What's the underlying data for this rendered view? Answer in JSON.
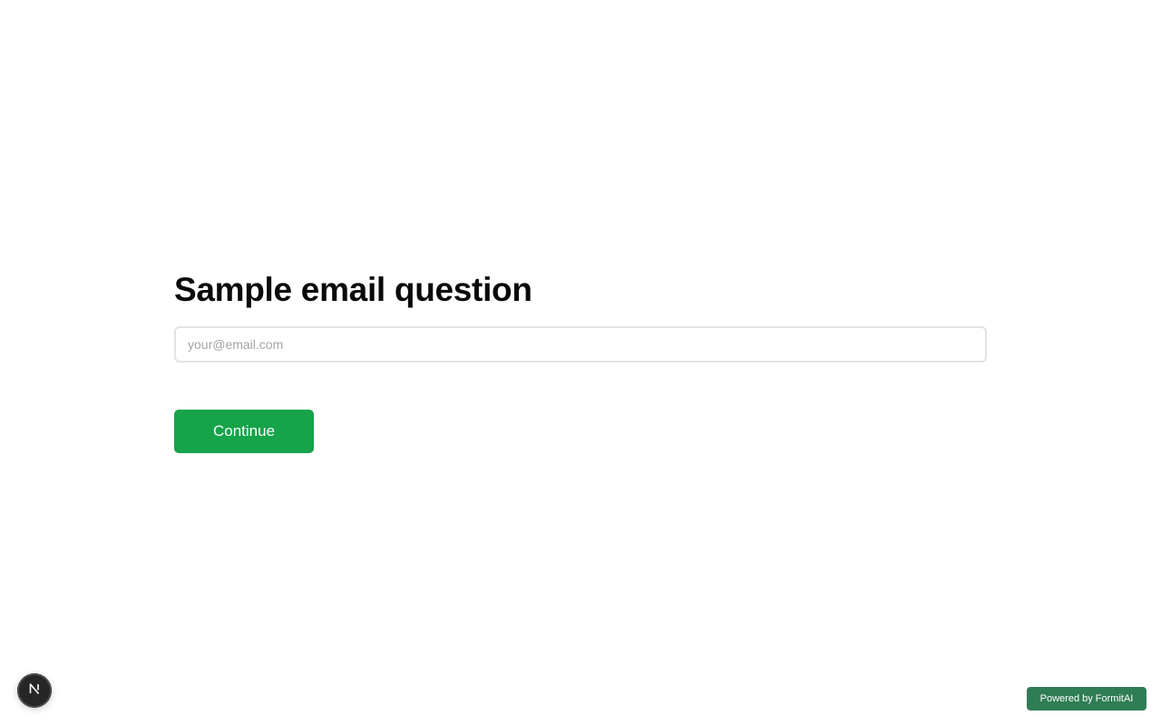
{
  "question": {
    "title": "Sample email question",
    "input_placeholder": "your@email.com",
    "input_value": "",
    "continue_label": "Continue"
  },
  "footer": {
    "dev_badge_icon": "nextjs-logo-icon",
    "powered_by": "Powered by FormitAI"
  },
  "colors": {
    "primary_button": "#16a34a",
    "powered_badge": "#2f7d55",
    "dev_badge": "#262626"
  }
}
